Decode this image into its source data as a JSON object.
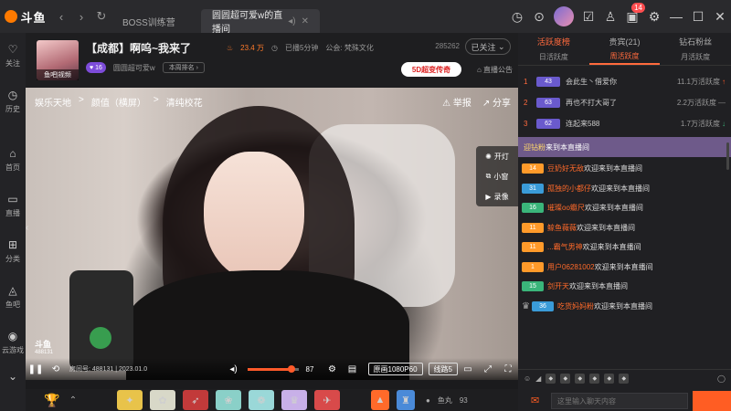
{
  "topbar": {
    "logo": "斗鱼",
    "tabs": [
      {
        "label": "BOSS训练营"
      },
      {
        "label": "圆圆超可爱w的直播间"
      }
    ],
    "notification_count": "14"
  },
  "sidebar": [
    {
      "label": "关注",
      "icon": "heart-icon"
    },
    {
      "label": "历史",
      "icon": "clock-icon"
    },
    {
      "label": "首页",
      "icon": "home-icon"
    },
    {
      "label": "直播",
      "icon": "tv-icon"
    },
    {
      "label": "分类",
      "icon": "grid-icon"
    },
    {
      "label": "鱼吧",
      "icon": "fish-icon"
    },
    {
      "label": "云游戏",
      "icon": "gamepad-icon"
    }
  ],
  "room": {
    "title": "【成都】啊呜~我来了",
    "hotness": "23.4 万",
    "live_duration": "已播5分钟",
    "guild": "公会: 梵殊文化",
    "room_id": "285262",
    "follow_label": "已关注",
    "host_name": "圆圆超可爱w",
    "fan_level": "16",
    "rank_button": "本周排名",
    "promo": "5D超变传奇",
    "announcement": "直播公告",
    "avatar_tag": "鱼吧|视频"
  },
  "video": {
    "breadcrumb": [
      "娱乐天地",
      ">",
      "颜值（横屏）",
      ">",
      "清纯校花"
    ],
    "report": "举报",
    "share": "分享",
    "tools": [
      "开灯",
      "小窗",
      "录像"
    ],
    "watermark_brand": "斗鱼",
    "watermark_id": "488131",
    "meta": "房间号: 488131 | 2023.01.0",
    "volume": 87,
    "quality": "原画1080P60",
    "line": "线路5"
  },
  "giftbar": {
    "fishball_label": "鱼丸",
    "fishball_count": "93"
  },
  "right_panel": {
    "tabs": [
      "活跃度榜",
      "贵宾(21)",
      "钻石粉丝"
    ],
    "sub_tabs": [
      "日活跃度",
      "周活跃度",
      "月活跃度"
    ],
    "ranking": [
      {
        "rank": "1",
        "level": "43",
        "name": "会此生丶借爱你",
        "score": "11.1万活跃度"
      },
      {
        "rank": "2",
        "level": "63",
        "name": "再也不打大哥了",
        "score": "2.2万活跃度"
      },
      {
        "rank": "3",
        "level": "62",
        "name": "连起来588",
        "score": "1.7万活跃度"
      }
    ],
    "enter_banner": {
      "nick": "迎钻粉",
      "text": "来到本直播间"
    },
    "chat": [
      {
        "level": "14",
        "nick": "豆奶好无敌",
        "text": "欢迎来到本直播间",
        "color": "#ff9a2a"
      },
      {
        "level": "31",
        "nick": "孤独的小都仔",
        "text": "欢迎来到本直播间",
        "color": "#3a9bd8"
      },
      {
        "level": "16",
        "nick": "璀璨oo瓣尺",
        "text": "欢迎来到本直播间",
        "color": "#3ab57a"
      },
      {
        "level": "11",
        "nick": "鲸鱼薇薇",
        "text": "欢迎来到本直播间",
        "color": "#ff9a2a"
      },
      {
        "level": "11",
        "nick": "...霸气男神",
        "text": "欢迎来到本直播间",
        "color": "#ff9a2a"
      },
      {
        "level": "1",
        "nick": "用户06281002",
        "text": "欢迎来到本直播间",
        "color": "#ff9a2a"
      },
      {
        "level": "15",
        "nick": "剑开天",
        "text": "欢迎来到本直播间",
        "color": "#3ab57a"
      },
      {
        "level": "36",
        "nick": "吃货妈妈粉",
        "text": "欢迎来到本直播间",
        "color": "#3a9bd8"
      }
    ],
    "input_placeholder": "这里输入聊天内容"
  }
}
